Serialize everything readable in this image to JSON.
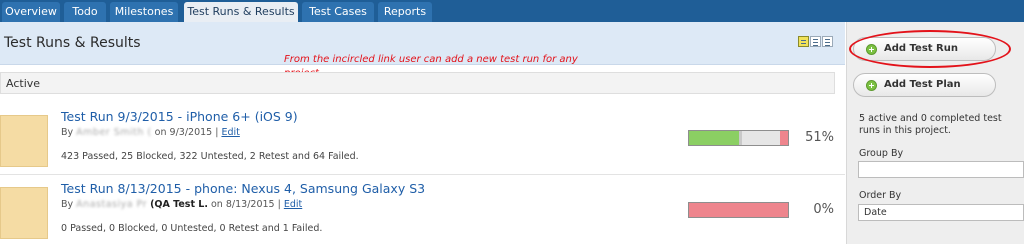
{
  "nav": {
    "tabs": [
      {
        "label": "Overview"
      },
      {
        "label": "Todo"
      },
      {
        "label": "Milestones"
      },
      {
        "label": "Test Runs & Results"
      },
      {
        "label": "Test Cases"
      },
      {
        "label": "Reports"
      }
    ],
    "active_tab": "Test Runs & Results"
  },
  "header": {
    "title": "Test Runs & Results",
    "annotation": "From the incircled link user can add a new test run for any project."
  },
  "section": {
    "label": "Active"
  },
  "runs": [
    {
      "title": "Test Run 9/3/2015 - iPhone 6+ (iOS 9)",
      "by_prefix": "By",
      "author": "Amber Smith (",
      "author_suffix": "",
      "on_prefix": "on",
      "date": "9/3/2015",
      "edit": "Edit",
      "summary": "423 Passed, 25 Blocked, 322 Untested, 2 Retest and 64 Failed.",
      "progress_percent": "51%",
      "progress_segments": [
        {
          "status": "passed",
          "fraction": 0.506,
          "color": "#8bcf63"
        },
        {
          "status": "blocked",
          "fraction": 0.03,
          "color": "#c9c9c9"
        },
        {
          "status": "untested",
          "fraction": 0.385,
          "color": "#e6e6e6"
        },
        {
          "status": "retest",
          "fraction": 0.003,
          "color": "#f2cf5b"
        },
        {
          "status": "failed",
          "fraction": 0.076,
          "color": "#ee858d"
        }
      ]
    },
    {
      "title": "Test Run 8/13/2015 - phone: Nexus 4, Samsung Galaxy S3",
      "by_prefix": "By",
      "author": "Anastasiya Pr",
      "author_suffix": "(QA Test L.",
      "on_prefix": "on",
      "date": "8/13/2015",
      "edit": "Edit",
      "summary": "0 Passed, 0 Blocked, 0 Untested, 0 Retest and 1 Failed.",
      "progress_percent": "0%",
      "progress_segments": [
        {
          "status": "failed",
          "fraction": 1.0,
          "color": "#ee858d"
        }
      ]
    }
  ],
  "sidebar": {
    "add_test_run": "Add Test Run",
    "add_test_plan": "Add Test Plan",
    "summary": "5 active and 0 completed test runs in this project.",
    "group_by_label": "Group By",
    "group_by_value": "",
    "order_by_label": "Order By",
    "order_by_value": "Date"
  }
}
